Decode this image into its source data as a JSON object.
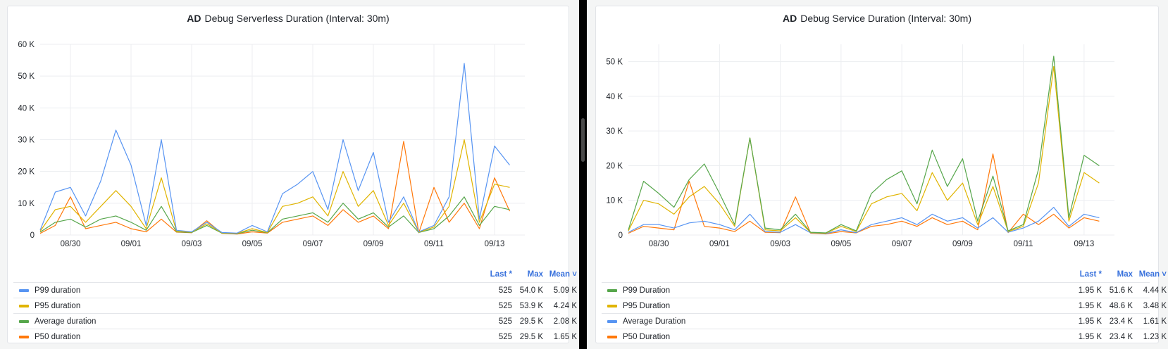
{
  "chart_data": [
    {
      "type": "line",
      "title_badge": "AD",
      "title": "Debug  Serverless Duration (Interval: 30m)",
      "x_ticks": [
        "08/30",
        "09/01",
        "09/03",
        "09/05",
        "09/07",
        "09/09",
        "09/11",
        "09/13"
      ],
      "y_ticks": [
        "0",
        "10 K",
        "20 K",
        "30 K",
        "40 K",
        "50 K",
        "60 K"
      ],
      "ylim": [
        0,
        60000
      ],
      "grid": true,
      "legend_placement": "bottom",
      "legend_columns": [
        "Last *",
        "Max",
        "Mean ˅"
      ],
      "x": [
        "08/29 00:00",
        "08/29 12:00",
        "08/30 00:00",
        "08/30 12:00",
        "08/31 00:00",
        "08/31 12:00",
        "09/01 00:00",
        "09/01 12:00",
        "09/02 00:00",
        "09/02 12:00",
        "09/03 00:00",
        "09/03 12:00",
        "09/04 00:00",
        "09/04 12:00",
        "09/05 00:00",
        "09/05 12:00",
        "09/06 00:00",
        "09/06 12:00",
        "09/07 00:00",
        "09/07 12:00",
        "09/08 00:00",
        "09/08 12:00",
        "09/09 00:00",
        "09/09 12:00",
        "09/10 00:00",
        "09/10 12:00",
        "09/11 00:00",
        "09/11 12:00",
        "09/12 00:00",
        "09/12 12:00",
        "09/13 00:00",
        "09/13 12:00"
      ],
      "series": [
        {
          "name": "P99 duration",
          "color": "#5794f2",
          "last": "525",
          "max": "54.0 K",
          "mean": "5.09 K",
          "values": [
            1500,
            13500,
            15000,
            6000,
            17000,
            33000,
            22000,
            3000,
            30000,
            1500,
            1000,
            4000,
            800,
            600,
            3000,
            1000,
            13000,
            16000,
            20000,
            8000,
            30000,
            14000,
            26000,
            4000,
            12000,
            1000,
            3000,
            12000,
            54000,
            5000,
            28000,
            22000
          ]
        },
        {
          "name": "P95 duration",
          "color": "#e0b400",
          "last": "525",
          "max": "53.9 K",
          "mean": "4.24 K",
          "values": [
            1200,
            8000,
            9000,
            4000,
            9000,
            14000,
            9000,
            2000,
            18000,
            1200,
            900,
            3500,
            700,
            500,
            2000,
            800,
            9000,
            10000,
            12000,
            6000,
            20000,
            9000,
            14000,
            3000,
            10000,
            900,
            2500,
            9000,
            30000,
            4000,
            16000,
            15000
          ]
        },
        {
          "name": "Average duration",
          "color": "#56a64b",
          "last": "525",
          "max": "29.5 K",
          "mean": "2.08 K",
          "values": [
            900,
            4000,
            5000,
            2500,
            5000,
            6000,
            4000,
            1500,
            9000,
            1000,
            800,
            3000,
            600,
            400,
            1500,
            700,
            5000,
            6000,
            7000,
            4000,
            10000,
            5000,
            7000,
            2500,
            6000,
            800,
            2000,
            6000,
            12000,
            3000,
            9000,
            8000
          ]
        },
        {
          "name": "P50 duration",
          "color": "#ff780a",
          "last": "525",
          "max": "29.5 K",
          "mean": "1.65 K",
          "values": [
            500,
            3000,
            12000,
            2000,
            3000,
            4000,
            2000,
            1000,
            5000,
            900,
            700,
            4500,
            500,
            300,
            1000,
            600,
            4000,
            5000,
            6000,
            3000,
            8000,
            4000,
            6000,
            2000,
            29500,
            700,
            15000,
            4000,
            10000,
            2000,
            18000,
            7500
          ]
        }
      ]
    },
    {
      "type": "line",
      "title_badge": "AD",
      "title": "Debug  Service Duration (Interval: 30m)",
      "x_ticks": [
        "08/30",
        "09/01",
        "09/03",
        "09/05",
        "09/07",
        "09/09",
        "09/11",
        "09/13"
      ],
      "y_ticks": [
        "0",
        "10 K",
        "20 K",
        "30 K",
        "40 K",
        "50 K"
      ],
      "ylim": [
        0,
        55000
      ],
      "grid": true,
      "legend_placement": "bottom",
      "legend_columns": [
        "Last *",
        "Max",
        "Mean ˅"
      ],
      "x": [
        "08/29 00:00",
        "08/29 12:00",
        "08/30 00:00",
        "08/30 12:00",
        "08/31 00:00",
        "08/31 12:00",
        "09/01 00:00",
        "09/01 12:00",
        "09/02 00:00",
        "09/02 12:00",
        "09/03 00:00",
        "09/03 12:00",
        "09/04 00:00",
        "09/04 12:00",
        "09/05 00:00",
        "09/05 12:00",
        "09/06 00:00",
        "09/06 12:00",
        "09/07 00:00",
        "09/07 12:00",
        "09/08 00:00",
        "09/08 12:00",
        "09/09 00:00",
        "09/09 12:00",
        "09/10 00:00",
        "09/10 12:00",
        "09/11 00:00",
        "09/11 12:00",
        "09/12 00:00",
        "09/12 12:00",
        "09/13 00:00",
        "09/13 12:00"
      ],
      "series": [
        {
          "name": "P99 Duration",
          "color": "#56a64b",
          "last": "1.95 K",
          "max": "51.6 K",
          "mean": "4.44 K",
          "values": [
            1500,
            15500,
            12000,
            8000,
            16000,
            20500,
            12000,
            3000,
            28000,
            2000,
            1500,
            6000,
            800,
            600,
            3000,
            1200,
            12000,
            16000,
            18500,
            9000,
            24500,
            14000,
            22000,
            4000,
            17000,
            1200,
            3000,
            19000,
            51600,
            5000,
            23000,
            20000
          ]
        },
        {
          "name": "P95 Duration",
          "color": "#e0b400",
          "last": "1.95 K",
          "max": "48.6 K",
          "mean": "3.48 K",
          "values": [
            1200,
            10000,
            9000,
            6000,
            11000,
            14000,
            9000,
            2500,
            28000,
            1500,
            1200,
            5000,
            700,
            500,
            2500,
            1000,
            9000,
            11000,
            12000,
            7000,
            18000,
            10000,
            15000,
            3000,
            14000,
            1000,
            2500,
            15000,
            48600,
            4000,
            18000,
            15000
          ]
        },
        {
          "name": "Average Duration",
          "color": "#5794f2",
          "last": "1.95 K",
          "max": "23.4 K",
          "mean": "1.61 K",
          "values": [
            800,
            3000,
            3000,
            2000,
            3500,
            4000,
            3000,
            1500,
            6000,
            1000,
            800,
            3000,
            600,
            400,
            1500,
            700,
            3000,
            4000,
            5000,
            3000,
            6000,
            4000,
            5000,
            2000,
            5000,
            800,
            2000,
            4000,
            8000,
            2500,
            6000,
            5000
          ]
        },
        {
          "name": "P50 Duration",
          "color": "#ff780a",
          "last": "1.95 K",
          "max": "23.4 K",
          "mean": "1.23 K",
          "values": [
            500,
            2500,
            2000,
            1500,
            15500,
            2500,
            2000,
            1000,
            4000,
            800,
            700,
            11000,
            500,
            300,
            1000,
            600,
            2500,
            3000,
            4000,
            2500,
            5000,
            3000,
            4000,
            1500,
            23400,
            700,
            6000,
            3000,
            6000,
            2000,
            5000,
            4000
          ]
        }
      ]
    }
  ]
}
